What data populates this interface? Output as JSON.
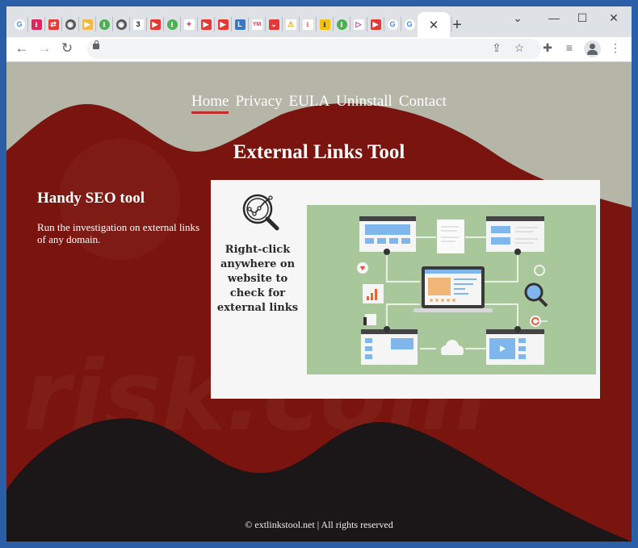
{
  "browser": {
    "tab_favicons": [
      {
        "name": "google",
        "label": "G",
        "bg": "#ffffff",
        "fg": "#4285f4",
        "shape": "circle"
      },
      {
        "name": "download-pink",
        "label": "⭳",
        "bg": "#e0245e",
        "fg": "#ffffff",
        "shape": "square"
      },
      {
        "name": "red-arrows",
        "label": "⇄",
        "bg": "#e53935",
        "fg": "#ffffff",
        "shape": "square"
      },
      {
        "name": "globe-dark",
        "label": "◉",
        "bg": "#555555",
        "fg": "#ffffff",
        "shape": "circle"
      },
      {
        "name": "video-camera",
        "label": "▶",
        "bg": "#f4b942",
        "fg": "#ffffff",
        "shape": "square"
      },
      {
        "name": "download-green",
        "label": "⭳",
        "bg": "#4caf50",
        "fg": "#ffffff",
        "shape": "circle"
      },
      {
        "name": "globe-dark-2",
        "label": "◉",
        "bg": "#555555",
        "fg": "#ffffff",
        "shape": "circle"
      },
      {
        "name": "three-logo",
        "label": "3",
        "bg": "#ffffff",
        "fg": "#222222",
        "shape": "square"
      },
      {
        "name": "red-play",
        "label": "▶",
        "bg": "#e53935",
        "fg": "#ffffff",
        "shape": "square"
      },
      {
        "name": "download-green-2",
        "label": "⭳",
        "bg": "#4caf50",
        "fg": "#ffffff",
        "shape": "circle"
      },
      {
        "name": "bird",
        "label": "✦",
        "bg": "#ffffff",
        "fg": "#e04a7a",
        "shape": "square"
      },
      {
        "name": "youtube-red",
        "label": "▶",
        "bg": "#e53935",
        "fg": "#ffffff",
        "shape": "square"
      },
      {
        "name": "youtube-red-2",
        "label": "▶",
        "bg": "#e53935",
        "fg": "#ffffff",
        "shape": "square"
      },
      {
        "name": "l-logo",
        "label": "L",
        "bg": "#3b78c4",
        "fg": "#ffffff",
        "shape": "square"
      },
      {
        "name": "ym-logo",
        "label": "YM",
        "bg": "#ffffff",
        "fg": "#d63b5e",
        "shape": "square"
      },
      {
        "name": "pocket-down",
        "label": "⌄",
        "bg": "#e53935",
        "fg": "#ffffff",
        "shape": "square"
      },
      {
        "name": "warning",
        "label": "⚠",
        "bg": "#ffffff",
        "fg": "#f0a400",
        "shape": "square"
      },
      {
        "name": "download-light-red",
        "label": "⭳",
        "bg": "#ffffff",
        "fg": "#f07060",
        "shape": "square"
      },
      {
        "name": "download-yellow",
        "label": "⭳",
        "bg": "#f4c20d",
        "fg": "#222222",
        "shape": "square"
      },
      {
        "name": "download-green-3",
        "label": "⭳",
        "bg": "#4caf50",
        "fg": "#ffffff",
        "shape": "circle"
      },
      {
        "name": "play-purple",
        "label": "▷",
        "bg": "#ffffff",
        "fg": "#b0308c",
        "shape": "square"
      },
      {
        "name": "youtube",
        "label": "▶",
        "bg": "#e53935",
        "fg": "#ffffff",
        "shape": "square"
      },
      {
        "name": "google-2",
        "label": "G",
        "bg": "#ffffff",
        "fg": "#4285f4",
        "shape": "circle"
      },
      {
        "name": "google-3",
        "label": "G",
        "bg": "#ffffff",
        "fg": "#4285f4",
        "shape": "circle"
      },
      {
        "name": "puzzle-blue",
        "label": "✚",
        "bg": "#ffffff",
        "fg": "#2b62c9",
        "shape": "square"
      },
      {
        "name": "rainbow",
        "label": "◠",
        "bg": "#ffffff",
        "fg": "#e0453a",
        "shape": "square"
      }
    ],
    "active_tab_close": "✕",
    "new_tab": "+",
    "window_controls": {
      "dropdown": "⌄",
      "minimize": "—",
      "maximize": "☐",
      "close": "✕"
    },
    "nav": {
      "back": "←",
      "forward": "→",
      "reload": "↻"
    },
    "toolbar_icons": {
      "share": "⇪",
      "bookmark": "☆",
      "extensions": "✚",
      "media": "≡",
      "menu": "⋮"
    },
    "url": ""
  },
  "site": {
    "colors": {
      "top_gray": "#b5b5a8",
      "red": "#7a140e",
      "dark": "#1b1719",
      "accent": "#c0302a"
    },
    "nav": [
      {
        "label": "Home",
        "active": true
      },
      {
        "label": "Privacy",
        "active": false
      },
      {
        "label": "EULA",
        "active": false
      },
      {
        "label": "Uninstall",
        "active": false
      },
      {
        "label": "Contact",
        "active": false
      }
    ],
    "title": "External Links Tool",
    "side": {
      "heading": "Handy SEO tool",
      "text": "Run the investigation on external links of any domain."
    },
    "promo": {
      "text": "Right-click anywhere on website to check for external links"
    },
    "footer": "© extlinkstool.net | All rights reserved"
  }
}
